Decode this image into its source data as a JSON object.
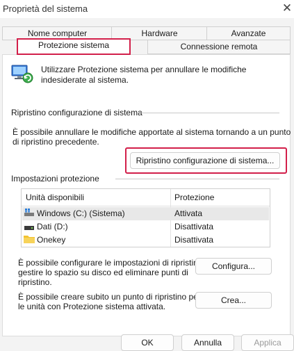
{
  "window": {
    "title": "Proprietà del sistema"
  },
  "tabs": [
    {
      "label": "Nome computer"
    },
    {
      "label": "Hardware"
    },
    {
      "label": "Avanzate"
    },
    {
      "label": "Protezione sistema",
      "selected": true
    },
    {
      "label": "Connessione remota"
    }
  ],
  "intro": {
    "text_line1": "Utilizzare Protezione sistema per annullare le modifiche",
    "text_line2": "indesiderate al sistema."
  },
  "restore": {
    "heading": "Ripristino configurazione di sistema",
    "desc_line1": "È possibile annullare le modifiche apportate al sistema tornando a un punto",
    "desc_line2": "di ripristino precedente.",
    "button": "Ripristino configurazione di sistema..."
  },
  "protection": {
    "heading": "Impostazioni protezione",
    "columns": [
      "Unità disponibili",
      "Protezione"
    ],
    "drives": [
      {
        "name": "Windows (C:) (Sistema)",
        "status": "Attivata",
        "icon": "windows-drive-icon"
      },
      {
        "name": "Dati (D:)",
        "status": "Disattivata",
        "icon": "drive-icon"
      },
      {
        "name": "Onekey",
        "status": "Disattivata",
        "icon": "folder-icon"
      }
    ],
    "configure_line1": "È possibile configurare le impostazioni di ripristino,",
    "configure_line2": "gestire lo spazio su disco ed eliminare punti di",
    "configure_line3": "ripristino.",
    "configure_button": "Configura...",
    "create_line1": "È possibile creare subito un punto di ripristino per",
    "create_line2": "le unità con Protezione sistema attivata.",
    "create_button": "Crea..."
  },
  "footer": {
    "ok": "OK",
    "cancel": "Annulla",
    "apply": "Applica"
  },
  "colors": {
    "highlight": "#d21f4a",
    "background": "#f3f3f3"
  }
}
